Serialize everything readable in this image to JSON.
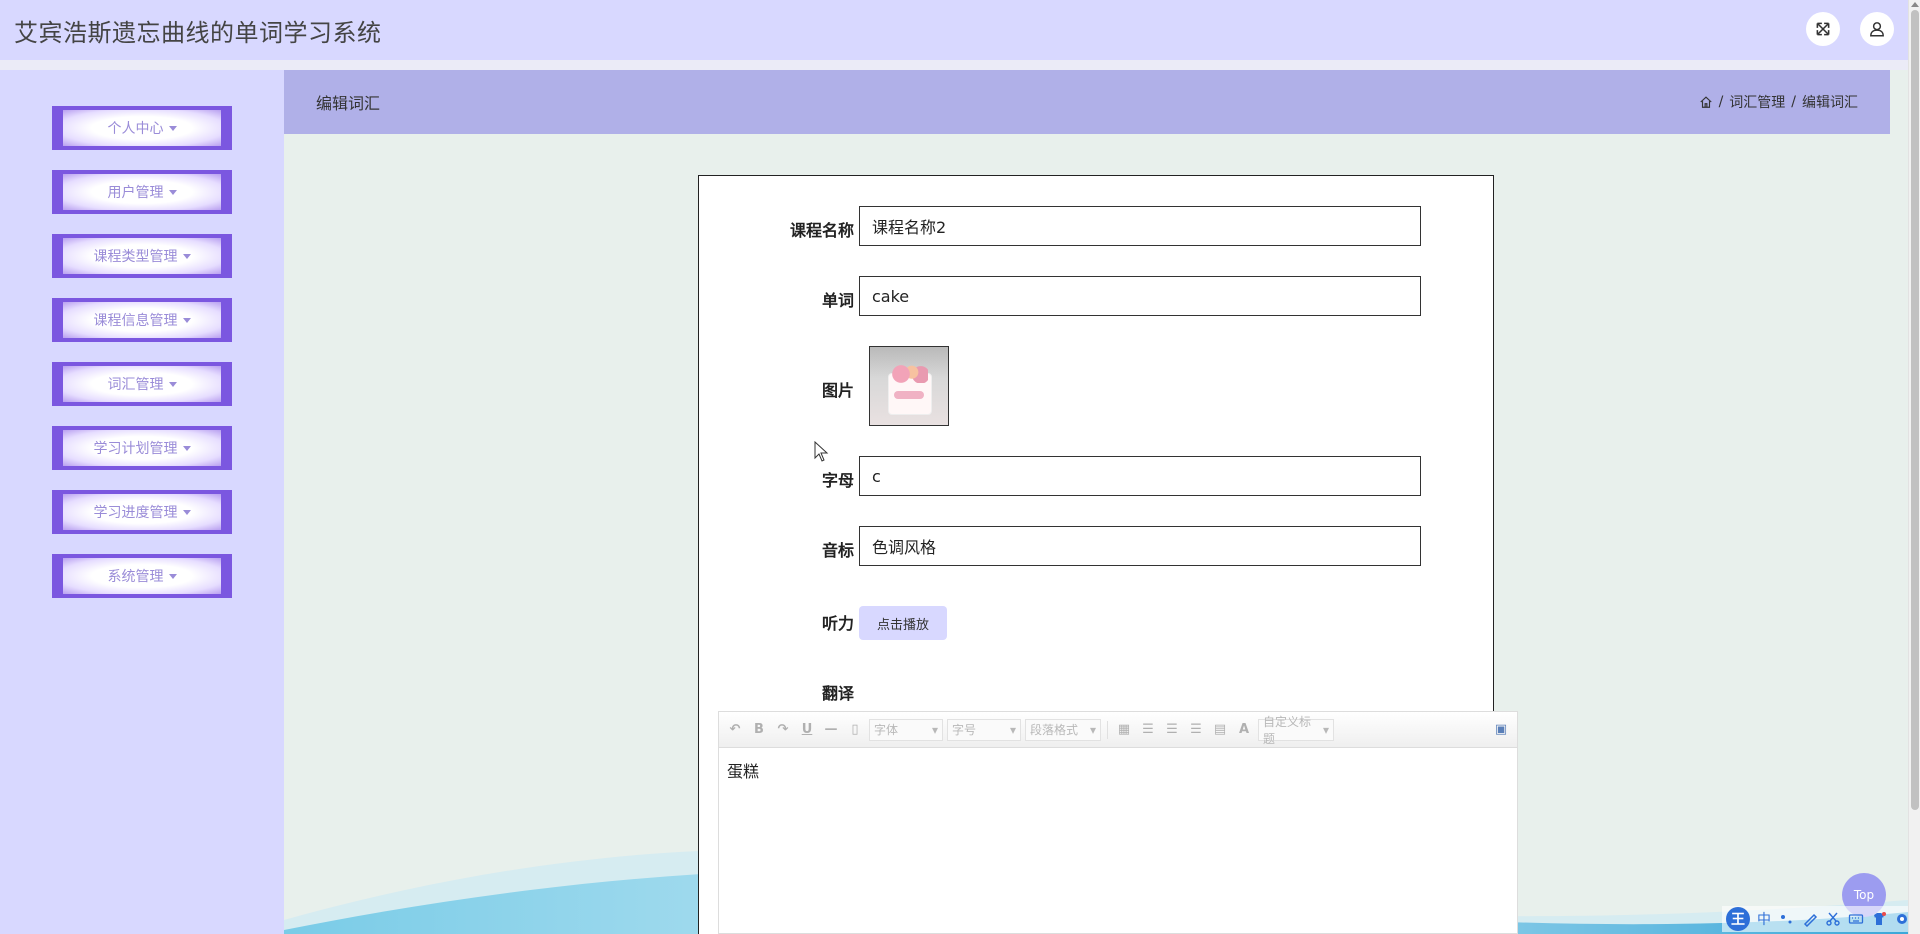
{
  "app": {
    "title": "艾宾浩斯遗忘曲线的单词学习系统"
  },
  "header_actions": {
    "fullscreen_icon": "fullscreen-icon",
    "user_icon": "user-icon"
  },
  "sidebar": {
    "items": [
      {
        "label": "个人中心"
      },
      {
        "label": "用户管理"
      },
      {
        "label": "课程类型管理"
      },
      {
        "label": "课程信息管理"
      },
      {
        "label": "词汇管理"
      },
      {
        "label": "学习计划管理"
      },
      {
        "label": "学习进度管理"
      },
      {
        "label": "系统管理"
      }
    ]
  },
  "page": {
    "title": "编辑词汇",
    "breadcrumb": {
      "home_icon": "home-icon",
      "sep": "/",
      "level1": "词汇管理",
      "level2": "编辑词汇"
    }
  },
  "form": {
    "course_name": {
      "label": "课程名称",
      "value": "课程名称2"
    },
    "word": {
      "label": "单词",
      "value": "cake"
    },
    "image": {
      "label": "图片"
    },
    "letter": {
      "label": "字母",
      "value": "c"
    },
    "phonetic": {
      "label": "音标",
      "value": "色调风格"
    },
    "listening": {
      "label": "听力",
      "button": "点击播放"
    },
    "translation": {
      "label": "翻译",
      "value": "蛋糕"
    }
  },
  "editor": {
    "font_family": "字体",
    "font_size": "字号",
    "paragraph": "段落格式",
    "custom_title": "自定义标题",
    "font_color_symbol": "A"
  },
  "top_button": {
    "label": "Top"
  },
  "ime": {
    "logo": "王",
    "mode": "中"
  },
  "colors": {
    "header_bg": "#d8d8ff",
    "sidebar_bg": "#d8d8ff",
    "menu_accent": "#7b57e0",
    "page_header_bg": "#b0b0e8",
    "content_bg": "#e8f0ec",
    "top_button_bg": "#9c9cf0"
  }
}
